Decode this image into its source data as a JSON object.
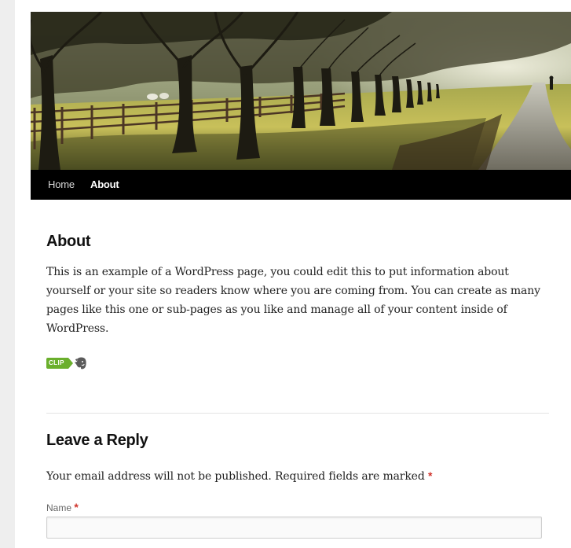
{
  "header": {
    "image_alt": "Tree-lined country path with fence and walker"
  },
  "nav": {
    "items": [
      {
        "label": "Home",
        "current": false
      },
      {
        "label": "About",
        "current": true
      }
    ]
  },
  "entry": {
    "title": "About",
    "text": "This is an example of a WordPress page, you could edit this to put information about yourself or your site so readers know where you are coming from. You can create as many pages like this one or sub-pages as you like and manage all of your content inside of WordPress.",
    "clip_label": "CLIP",
    "clip_icon": "evernote-elephant-icon"
  },
  "comments": {
    "reply_title": "Leave a Reply",
    "notes": "Your email address will not be published. Required fields are marked",
    "required_mark": "*",
    "name_label": "Name",
    "name_value": ""
  },
  "colors": {
    "nav_background": "#000000",
    "required": "#d0342c",
    "clip_badge": "#6aaf2c",
    "gutter": "#eeeeee"
  }
}
